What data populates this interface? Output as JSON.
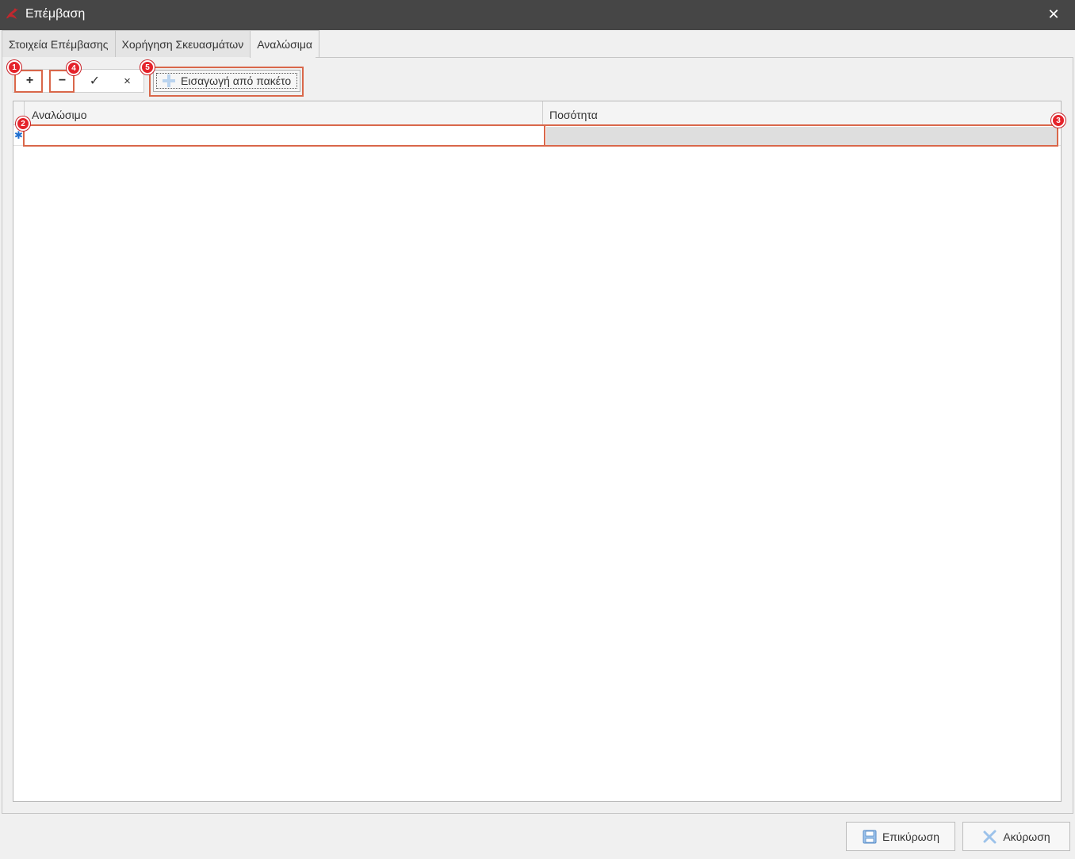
{
  "window": {
    "title": "Επέμβαση",
    "close_glyph": "✕",
    "app_icon": "app-logo-icon"
  },
  "tabs": [
    {
      "label": "Στοιχεία Επέμβασης",
      "active": false
    },
    {
      "label": "Χορήγηση Σκευασμάτων",
      "active": false
    },
    {
      "label": "Αναλώσιμα",
      "active": true
    }
  ],
  "toolbar": {
    "add_glyph": "+",
    "remove_glyph": "−",
    "confirm_glyph": "✓",
    "cancel_glyph": "×",
    "import_label": "Εισαγωγή από πακέτο"
  },
  "badges": [
    "1",
    "2",
    "3",
    "4",
    "5"
  ],
  "grid": {
    "columns": [
      "Αναλώσιμο",
      "Ποσότητα"
    ],
    "new_row_glyph": "✱",
    "new_row": {
      "item": "",
      "quantity": ""
    }
  },
  "footer": {
    "confirm_label": "Επικύρωση",
    "cancel_label": "Ακύρωση"
  },
  "colors": {
    "titlebar": "#464646",
    "highlight": "#d9674a",
    "badge": "#e5232b"
  }
}
